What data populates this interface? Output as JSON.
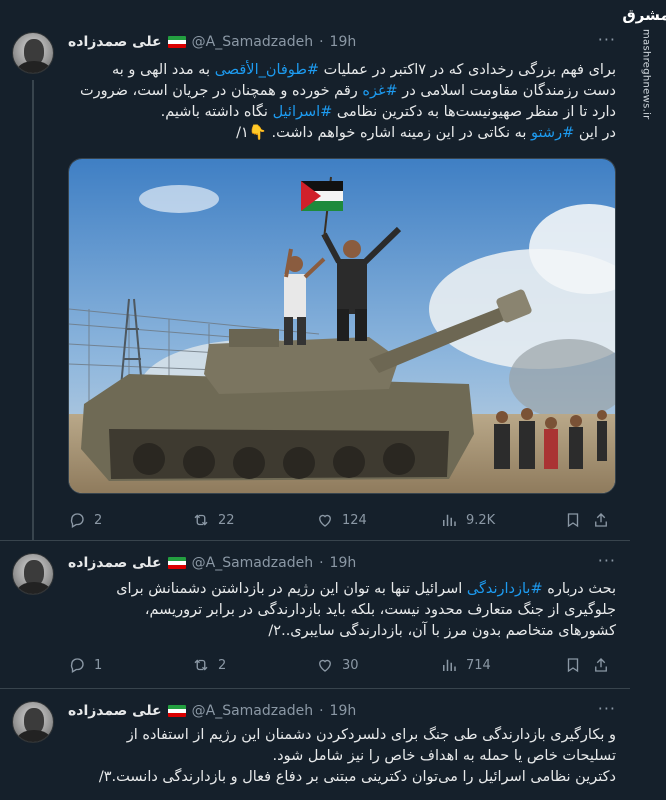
{
  "watermark": {
    "logo": "مشرق",
    "url": "mashreghnews.ir"
  },
  "tweets": [
    {
      "author": {
        "name": "علی صمدزاده",
        "handle": "@A_Samadzadeh",
        "time": "19h",
        "flag": [
          "#239f40",
          "#ffffff",
          "#da0000"
        ]
      },
      "text_segments": {
        "l1a": "برای فهم بزرگی رخدادی که در ۷اکتبر در عملیات ",
        "l1h": "#طوفان_الأقصی",
        "l1b": " به مدد الهی و به",
        "l2a": "دست رزمندگان مقاومت اسلامی در ",
        "l2h": "#غزه",
        "l2b": " رقم خورده و همچنان در جریان است، ضرورت",
        "l3a": "دارد تا از منظر صهیونیست‌ها به دکترین نظامی ",
        "l3h": "#اسرائیل",
        "l3b": " نگاه داشته باشیم.",
        "l4a": "در این ",
        "l4h": "#رشتو",
        "l4b": " به نکاتی در این زمینه اشاره خواهم داشت. ",
        "l4e": "👇",
        "l4c": "۱/"
      },
      "stats": {
        "replies": "2",
        "retweets": "22",
        "likes": "124",
        "views": "9.2K"
      }
    },
    {
      "author": {
        "name": "علی صمدزاده",
        "handle": "@A_Samadzadeh",
        "time": "19h"
      },
      "text_segments": {
        "l1a": "بحث درباره ",
        "l1h": "#بازدارندگی",
        "l1b": " اسرائیل تنها به توان این رژیم در بازداشتن دشمنانش برای",
        "l2": "جلوگیری از جنگ متعارف محدود نیست، بلکه باید بازدارندگی در برابر تروریسم،",
        "l3": "کشورهای متخاصم بدون مرز با آن، بازدارندگی سایبری..۲/"
      },
      "stats": {
        "replies": "1",
        "retweets": "2",
        "likes": "30",
        "views": "714"
      }
    },
    {
      "author": {
        "name": "علی صمدزاده",
        "handle": "@A_Samadzadeh",
        "time": "19h"
      },
      "text_segments": {
        "l1": "و بکارگیری بازدارندگی طی جنگ برای دلسردکردن دشمنان این رژیم از استفاده از",
        "l2": "تسلیحات خاص یا حمله به اهداف خاص را نیز شامل شود.",
        "l3": "دکترین نظامی اسرائیل را می‌توان دکترینی مبتنی بر دفاع فعال و بازدارندگی دانست.۳/"
      }
    }
  ],
  "colors": {
    "background": "#15202b",
    "link": "#1d9bf0",
    "muted": "#8b98a5"
  }
}
